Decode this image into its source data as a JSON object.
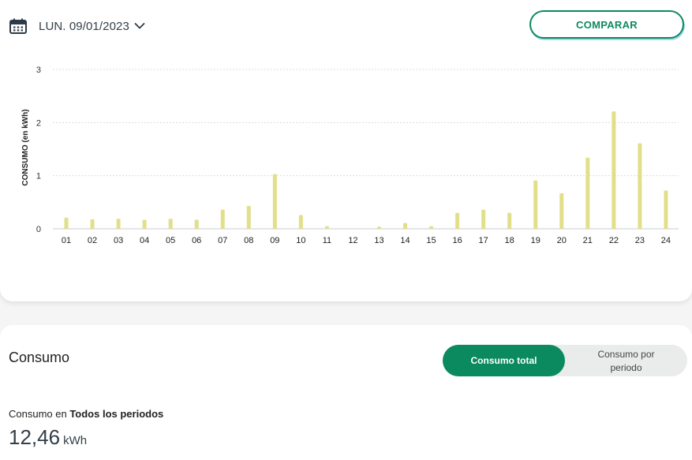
{
  "header": {
    "date_label": "LUN. 09/01/2023",
    "compare_label": "COMPARAR"
  },
  "chart_data": {
    "type": "bar",
    "ylabel": "CONSUMO (en kWh)",
    "xlabel": "",
    "ylim": [
      0,
      3
    ],
    "yticks": [
      0,
      1,
      2,
      3
    ],
    "grid": true,
    "bar_color": "#e2df8a",
    "categories": [
      "01",
      "02",
      "03",
      "04",
      "05",
      "06",
      "07",
      "08",
      "09",
      "10",
      "11",
      "12",
      "13",
      "14",
      "15",
      "16",
      "17",
      "18",
      "19",
      "20",
      "21",
      "22",
      "23",
      "24"
    ],
    "values": [
      0.21,
      0.18,
      0.19,
      0.17,
      0.19,
      0.17,
      0.36,
      0.43,
      1.03,
      0.26,
      0.05,
      0.0,
      0.04,
      0.11,
      0.05,
      0.3,
      0.36,
      0.3,
      0.91,
      0.67,
      1.34,
      2.21,
      1.61,
      0.72
    ]
  },
  "summary": {
    "title": "Consumo",
    "toggle_total": "Consumo total",
    "toggle_periodo": "Consumo por periodo",
    "consumo_prefix": "Consumo en ",
    "consumo_period": "Todos los periodos",
    "total_value": "12,46",
    "total_unit": "kWh"
  },
  "colors": {
    "accent": "#0b8a5f",
    "bars": "#e2df8a",
    "text_dark": "#333e48"
  },
  "icons": {
    "date": "calendar-icon",
    "dropdown": "chevron-down-icon"
  }
}
